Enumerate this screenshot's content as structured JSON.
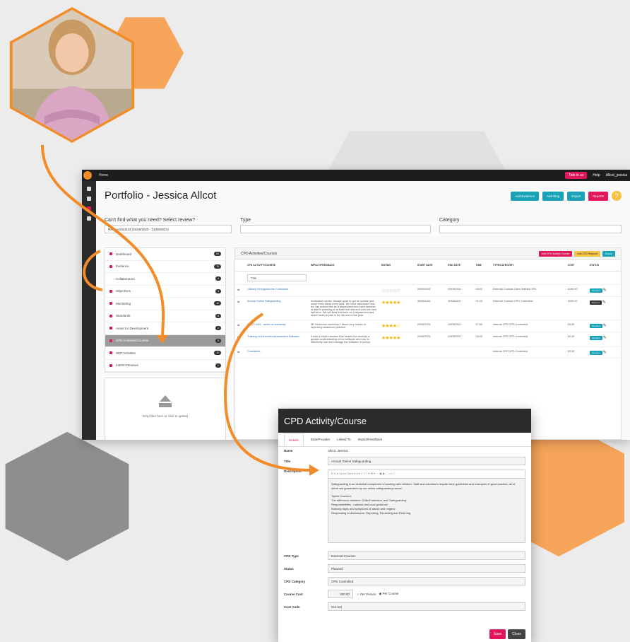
{
  "colors": {
    "orange": "#f28c28",
    "pink": "#e0185a",
    "teal": "#17a2b8",
    "dark": "#2b2b2b"
  },
  "topbar": {
    "home": "Home",
    "talk": "Talk to us",
    "help": "Help",
    "user": "Allcot_jessica"
  },
  "page": {
    "title": "Portfolio - Jessica Allcot",
    "actions": [
      "Add Evidence",
      "Add Blog",
      "Export",
      "Reports"
    ]
  },
  "filters": {
    "review_label": "Can't find what you need? Select review?",
    "review_value": "Review 2022/23 (01/09/2020 - 31/08/2024)",
    "type_label": "Type",
    "category_label": "Category"
  },
  "nav": [
    {
      "label": "Dashboard",
      "badge": ""
    },
    {
      "label": "Evidence",
      "badge": ""
    },
    {
      "label": "Collaborators",
      "badge": ""
    },
    {
      "label": "Objectives",
      "badge": ""
    },
    {
      "label": "Monitoring",
      "badge": ""
    },
    {
      "label": "Standards",
      "badge": ""
    },
    {
      "label": "Areas for Development",
      "badge": ""
    },
    {
      "label": "CPD Activities/Courses",
      "badge": ""
    },
    {
      "label": "SDP Activities",
      "badge": ""
    },
    {
      "label": "Interim Reviews",
      "badge": ""
    }
  ],
  "dropzone": "Drop files here or click to upload",
  "panel": {
    "title": "CPD Activities/Courses",
    "actions": [
      "Add CPD Activity/ Course",
      "Add CPD Request",
      "Export"
    ],
    "headers": [
      "CPD ACTIVITY/COURSE",
      "IMPACT/FEEDBACK",
      "RATING",
      "START DATE",
      "END DATE",
      "TIME",
      "TYPE/CATEGORY",
      "COST",
      "STATUS"
    ],
    "filter_placeholder": "Title",
    "rows": [
      {
        "title": "Literacy throughout the Curriculum",
        "impact": "",
        "start": "09/09/2021",
        "end": "09/09/2021",
        "time": "08:00",
        "type": "External Courses User Defined CPD",
        "cost": "£160.00",
        "status": "Attended",
        "status_dark": false,
        "stars": "☆☆☆☆☆"
      },
      {
        "title": "Annual Online Safeguarding",
        "impact": "Invaluable course. Always good to get an update and some fresh ideas every year. We have discussed how we can embed this as a department and each member of staff is planning in at least one element over the next half term. We will feed this back as a department and share ideas to plan in for the rest of the year.",
        "start": "30/08/2021",
        "end": "30/08/2021",
        "time": "01:00",
        "type": "External Courses CPD Controlled",
        "cost": "£200.00",
        "status": "Planned",
        "status_dark": true,
        "stars": "★★★★★"
      },
      {
        "title": "INSET DAY - series of workshop",
        "impact": "MY behaviour workshop I found very helpful in improving classroom practice",
        "start": "29/08/2021",
        "end": "29/08/2021",
        "time": "07:00",
        "type": "Internal CPD CPD Controlled",
        "cost": "£0.00",
        "status": "Attended",
        "status_dark": false,
        "stars": "★★★★☆"
      },
      {
        "title": "Training on Derventio Assessment Software",
        "impact": "It was a helpful session that helped me develop a greater understanding of the software and how to effectively use and manage the software in school.",
        "start": "20/08/2021",
        "end": "20/08/2021",
        "time": "08:00",
        "type": "Internal CPD CPD Controlled",
        "cost": "£0.00",
        "status": "Attended",
        "status_dark": false,
        "stars": "★★★★★"
      },
      {
        "title": "Consistent...",
        "impact": "",
        "start": "",
        "end": "",
        "time": "",
        "type": "Internal CPD CPD Controlled",
        "cost": "£0.00",
        "status": "Attended",
        "status_dark": false,
        "stars": ""
      }
    ]
  },
  "modal": {
    "title": "CPD Activity/Course",
    "tabs": [
      "Details",
      "Date/Provider",
      "Linked To",
      "Impact/Feedback"
    ],
    "name_label": "Name",
    "name_value": "Allcot, Jessica",
    "title_label": "Title",
    "title_value": "Annual Online Safeguarding",
    "desc_label": "Description",
    "toolbar": "B  U  ⌀   Open Sans ▾   A ▾   ≡  ≡  ≡ ▾   ⊞ ▾   ⇔  ▣  ▶   ⛶  </>  ?",
    "desc_lines": [
      "Safeguarding is an essential component of working with children. Staff and volunteers require clear guidelines and examples of good practice, all of which are guaranteed by our online safeguarding course.",
      "",
      "Topics Covered:",
      "The difference between 'Child Protection' and 'Safeguarding'",
      "Responsibilities - national and local guidance",
      "Noticing signs and symptoms of abuse and neglect",
      "Responding to disclosures: Reporting, Recording and Referring"
    ],
    "cpd_type_label": "CPD Type",
    "cpd_type_value": "External Courses",
    "status_label": "Status",
    "status_value": "Planned",
    "category_label": "CPD Category",
    "category_value": "CPD Controlled",
    "cost_label": "Course Cost",
    "cost_value": "200.00",
    "per_person": "Per Person",
    "per_course": "Per Course",
    "costcode_label": "Cost Code",
    "costcode_value": "Not Set",
    "save": "Save",
    "close": "Close"
  }
}
